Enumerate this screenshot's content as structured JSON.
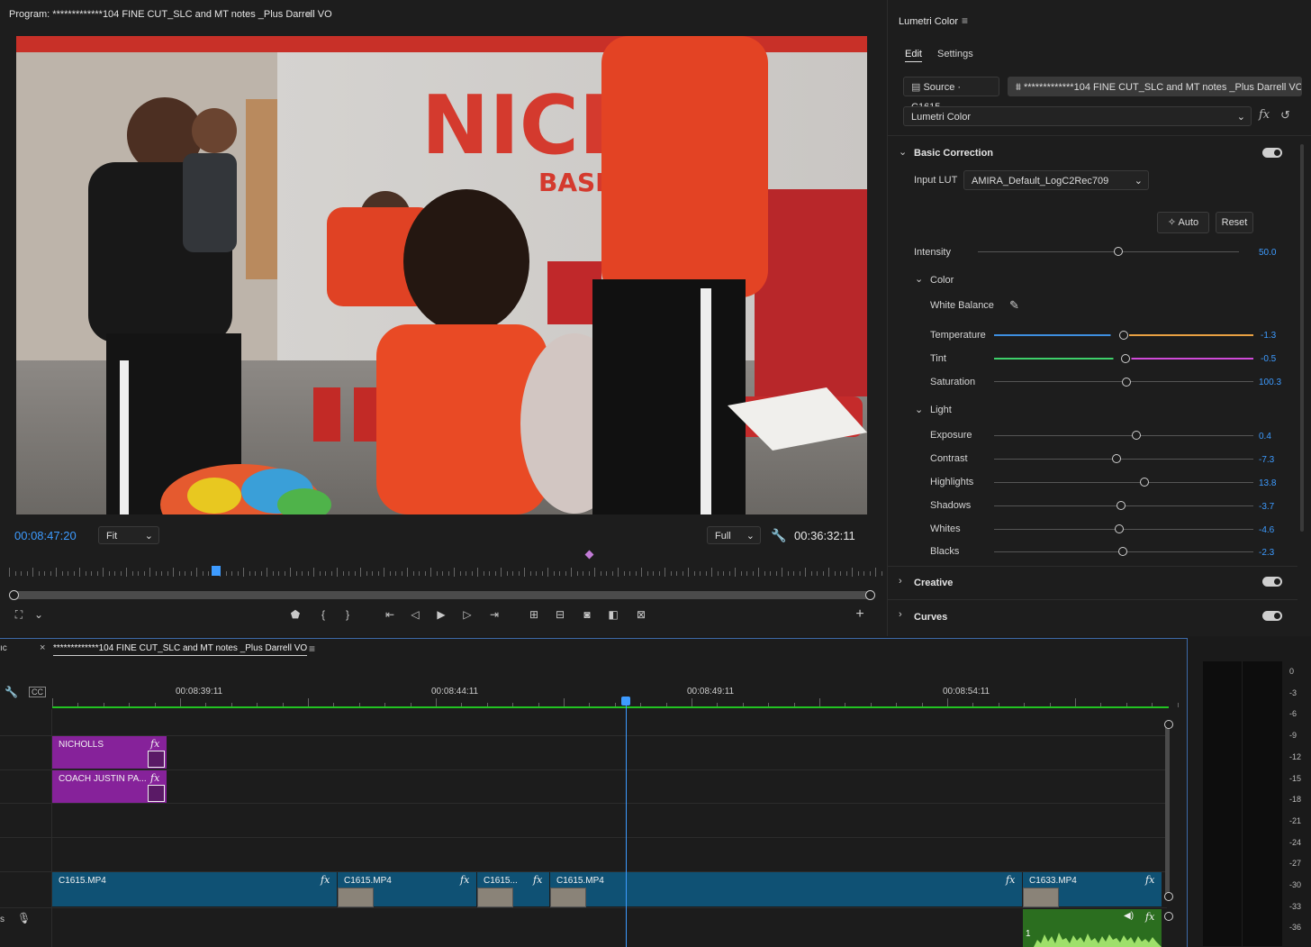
{
  "program": {
    "title": "Program: *************104 FINE CUT_SLC and MT notes _Plus Darrell VO",
    "menu_icon": "hamburger-icon",
    "video_description_text": {
      "wall_top": "NICHO",
      "wall_bottom": "BASKETBALL"
    },
    "current_timecode": "00:08:47:20",
    "fit_label": "Fit",
    "resolution_label": "Full",
    "duration_timecode": "00:36:32:11"
  },
  "lumetri": {
    "panel_title": "Lumetri Color",
    "tabs": [
      {
        "label": "Edit"
      },
      {
        "label": "Settings"
      }
    ],
    "source_label": "Source · C1615...",
    "sequence_label": "*************104 FINE CUT_SLC and MT notes _Plus Darrell VO ·...",
    "effect_select": "Lumetri Color",
    "fx_label": "fx",
    "basic_correction": {
      "title": "Basic Correction",
      "input_lut_label": "Input LUT",
      "input_lut_value": "AMIRA_Default_LogC2Rec709",
      "auto_label": "Auto",
      "reset_label": "Reset",
      "intensity_label": "Intensity",
      "intensity_value": "50.0",
      "color_section": "Color",
      "white_balance_label": "White Balance",
      "temperature_label": "Temperature",
      "temperature_value": "-1.3",
      "tint_label": "Tint",
      "tint_value": "-0.5",
      "saturation_label": "Saturation",
      "saturation_value": "100.3",
      "light_section": "Light",
      "exposure_label": "Exposure",
      "exposure_value": "0.4",
      "contrast_label": "Contrast",
      "contrast_value": "-7.3",
      "highlights_label": "Highlights",
      "highlights_value": "13.8",
      "shadows_label": "Shadows",
      "shadows_value": "-3.7",
      "whites_label": "Whites",
      "whites_value": "-4.6",
      "blacks_label": "Blacks",
      "blacks_value": "-2.3"
    },
    "creative_title": "Creative",
    "curves_title": "Curves"
  },
  "timeline": {
    "prev_tab_fragment": "ıc",
    "tab_label": "*************104 FINE CUT_SLC and MT notes _Plus Darrell VO",
    "ruler_times": [
      "00:08:39:11",
      "00:08:44:11",
      "00:08:49:11",
      "00:08:54:11"
    ],
    "title_clips": [
      {
        "name": "NICHOLLS"
      },
      {
        "name": "COACH JUSTIN PA..."
      }
    ],
    "video_clips": [
      {
        "name": "C1615.MP4"
      },
      {
        "name": "C1615.MP4"
      },
      {
        "name": "C1615..."
      },
      {
        "name": "C1615.MP4"
      },
      {
        "name": "C1633.MP4"
      }
    ],
    "audio_clip_label": "1",
    "track_label_s": "s"
  },
  "meter": {
    "db_labels": [
      "0",
      "-3",
      "-6",
      "-9",
      "-12",
      "-15",
      "-18",
      "-21",
      "-24",
      "-27",
      "-30",
      "-33",
      "-36"
    ]
  },
  "colors": {
    "accent_blue": "#3d9bff",
    "video_clip": "#0f5174",
    "title_clip": "#86229a",
    "audio_clip": "#2b6e1f",
    "work_area": "#22c322"
  }
}
